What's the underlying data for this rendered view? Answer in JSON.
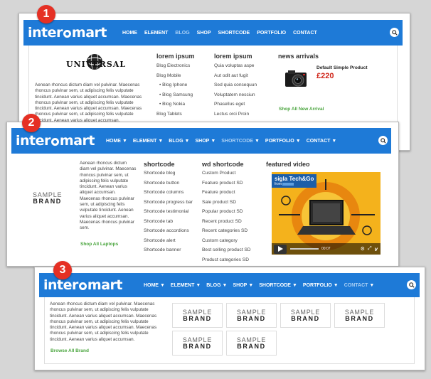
{
  "badges": [
    "1",
    "2",
    "3"
  ],
  "logo": {
    "left": "inter",
    "right": "mart"
  },
  "menu1": {
    "nav": [
      "HOME",
      "ELEMENT",
      "BLOG",
      "SHOP",
      "SHORTCODE",
      "PORTFOLIO",
      "CONTACT"
    ],
    "active_index": 2,
    "universal": "UNIVERSAL",
    "paragraph": "Aenean rhoncus dictum diam vel pulvinar. Maecenas rhoncus pulvinar sem, ut adipiscing felis vulputate tincidunt. Aenean varius aliquet accumsan. Maecenas rhoncus pulvinar sem, ut adipiscing felis vulputate tincidunt. Aenean varius aliquet accumsan. Maecenas rhoncus pulvinar sem, ut adipiscing felis vulputate tincidunt. Aenean varius aliquet accumsan.",
    "col1_title": "lorem ipsum",
    "col1_items": [
      "Blog Electronics",
      "Blog Mobile",
      "• Blog Iphone",
      "• Blog Samsung",
      "• Blog Nokia",
      "Blog Tablets"
    ],
    "col2_title": "lorem ipsum",
    "col2_items": [
      "Quia voluptas aspe",
      "Aut odit aut fugit",
      "Sed quia consequun",
      "Voluptatem nesciun",
      "Phasellus eget",
      "Lectus orci Proin"
    ],
    "news_title": "news arrivals",
    "product_name": "Default Simple Product",
    "product_price": "£220",
    "news_link": "Shop All New Arrival"
  },
  "menu2": {
    "nav": [
      "HOME",
      "ELEMENT",
      "BLOG",
      "SHOP",
      "SHORTCODE",
      "PORTFOLIO",
      "CONTACT"
    ],
    "active_index": 4,
    "brand_top": "SAMPLE",
    "brand_bottom": "BRAND",
    "paragraph": "Aenean rhoncus dictum diam vel pulvinar. Maecenas rhoncus pulvinar sem, ut adipiscing felis vulputate tincidunt. Aenean varius aliquet accumsan. Maecenas rhoncus pulvinar sem, ut adipiscing felis vulputate tincidunt. Aenean varius aliquet accumsan. Maecenas rhoncus pulvinar sem.",
    "laptops_link": "Shop All Laptops",
    "shortcode_title": "shortcode",
    "shortcode_items": [
      "Shortcode blog",
      "Shortcode button",
      "Shortcode columns",
      "Shortcode progress bar",
      "Shortcode testimonial",
      "Shortcode tab",
      "Shortcode accordions",
      "Shortcode alert",
      "Shortcode banner"
    ],
    "wd_title": "wd shortcode",
    "wd_items": [
      "Custom Product",
      "Feature product SD",
      "Feature product",
      "Sale product SD",
      "Popular product SD",
      "Recent product SD",
      "Recent categories SD",
      "Custom category",
      "Best selling product SD",
      "Product categories SD"
    ],
    "video_title": "featured video",
    "video_channel": "sigla Tech&Go",
    "video_from": "from",
    "video_time": "00:07"
  },
  "menu3": {
    "nav": [
      "HOME",
      "ELEMENT",
      "BLOG",
      "SHOP",
      "SHORTCODE",
      "PORTFOLIO",
      "CONTACT"
    ],
    "active_index": 6,
    "paragraph": "Aenean rhoncus dictum diam vel pulvinar. Maecenas rhoncus pulvinar sem, ut adipiscing felis vulputate tincidunt. Aenean varius aliquet accumsan. Maecenas rhoncus pulvinar sem, ut adipiscing felis vulputate tincidunt. Aenean varius aliquet accumsan. Maecenas rhoncus pulvinar sem, ut adipiscing felis vulputate tincidunt. Aenean varius aliquet accumsan.",
    "brand_top": "SAMPLE",
    "brand_bottom": "BRAND",
    "brand_link": "Browse All Brand"
  },
  "colors": {
    "nav_blue": "#1e7ad7",
    "badge_red": "#e53024",
    "link_green": "#4aa53e",
    "price_red": "#d0261a"
  }
}
